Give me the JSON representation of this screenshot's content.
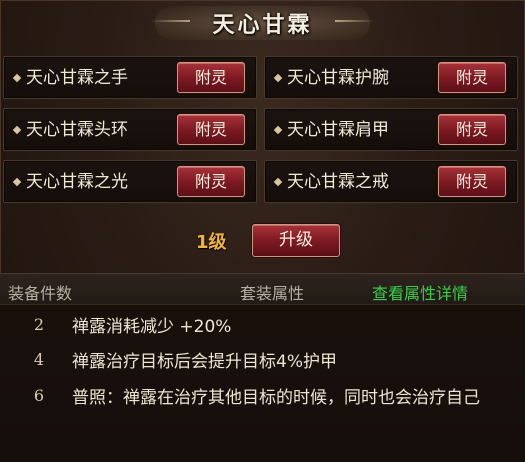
{
  "title": "天心甘霖",
  "items": [
    {
      "name": "天心甘霖之手",
      "button": "附灵"
    },
    {
      "name": "天心甘霖护腕",
      "button": "附灵"
    },
    {
      "name": "天心甘霖头环",
      "button": "附灵"
    },
    {
      "name": "天心甘霖肩甲",
      "button": "附灵"
    },
    {
      "name": "天心甘霖之光",
      "button": "附灵"
    },
    {
      "name": "天心甘霖之戒",
      "button": "附灵"
    }
  ],
  "level": {
    "text": "1级",
    "upgrade_label": "升级"
  },
  "table": {
    "header_count": "装备件数",
    "header_attr": "套装属性",
    "header_link": "查看属性详情",
    "rows": [
      {
        "count": "2",
        "desc": "禅露消耗减少 +20%"
      },
      {
        "count": "4",
        "desc": "禅露治疗目标后会提升目标4%护甲"
      },
      {
        "count": "6",
        "desc": "普照：禅露在治疗其他目标的时候，同时也会治疗自己"
      }
    ]
  },
  "colors": {
    "button_red": "#7e1a22",
    "level_orange": "#f0b43a",
    "link_green": "#39d04a"
  }
}
